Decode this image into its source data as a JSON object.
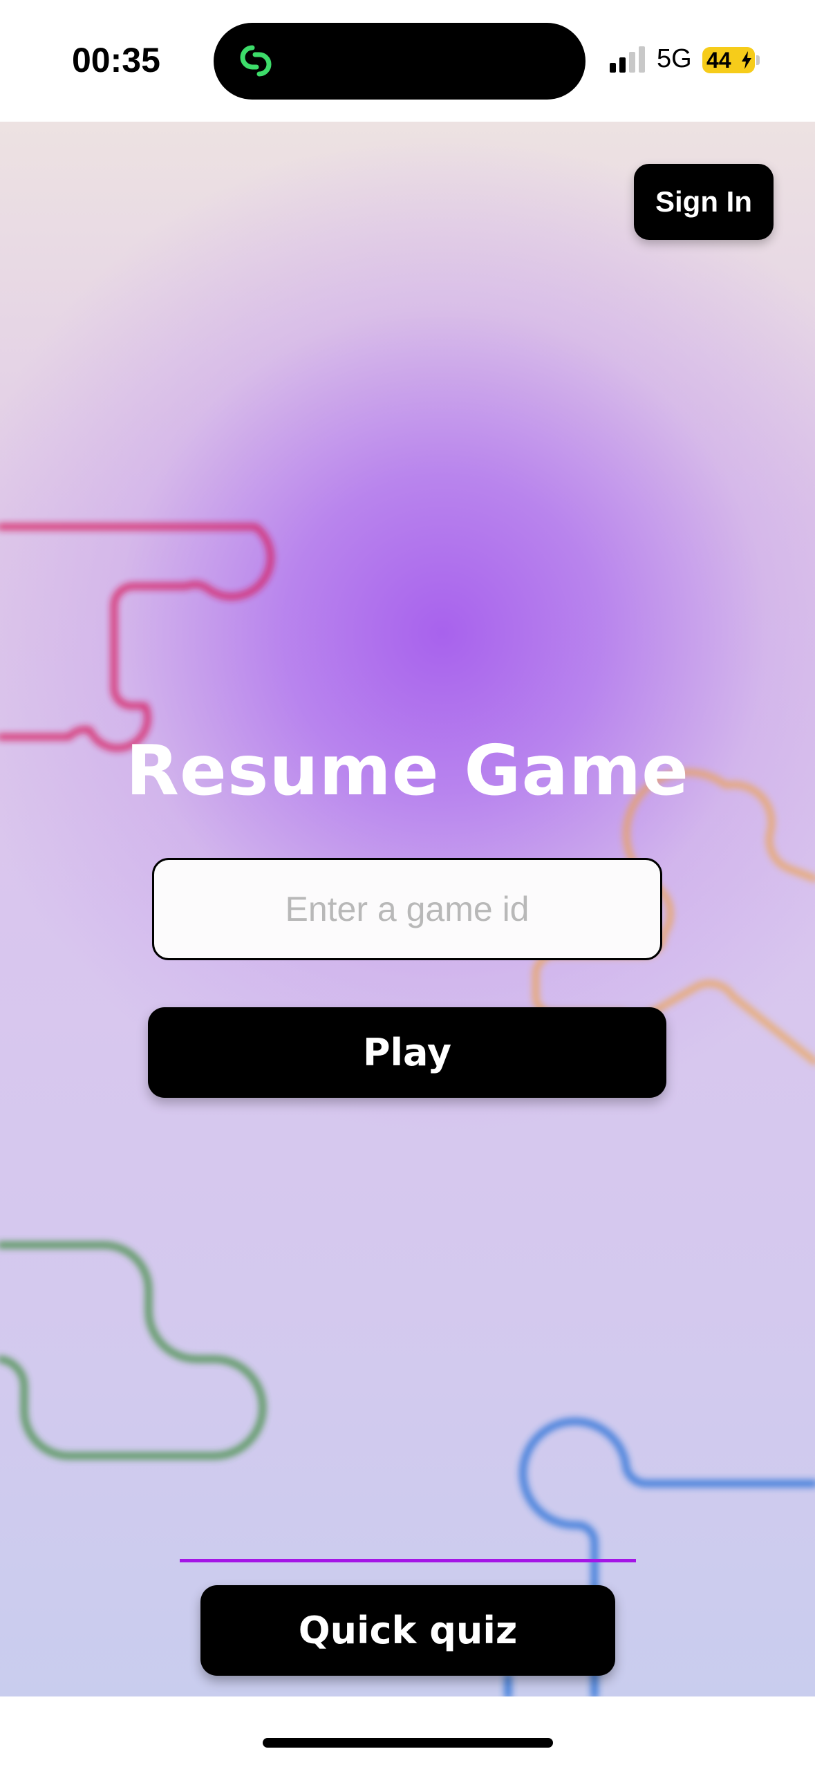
{
  "status_bar": {
    "time": "00:35",
    "network": "5G",
    "battery": "44",
    "battery_charging": true,
    "signal_bars_active": 2,
    "signal_bars_total": 4
  },
  "header": {
    "sign_in_label": "Sign In"
  },
  "main": {
    "title": "Resume Game",
    "game_id_input": {
      "value": "",
      "placeholder": "Enter a game id"
    },
    "play_label": "Play"
  },
  "footer": {
    "quick_quiz_label": "Quick quiz"
  },
  "colors": {
    "accent_divider": "#a415e6",
    "button_bg": "#000000",
    "battery_fill": "#f6cc1a",
    "island_icon": "#3ddc6a"
  },
  "icons": {
    "island": "linked-rings-icon",
    "signal": "cellular-signal-icon",
    "battery": "battery-charging-icon"
  }
}
